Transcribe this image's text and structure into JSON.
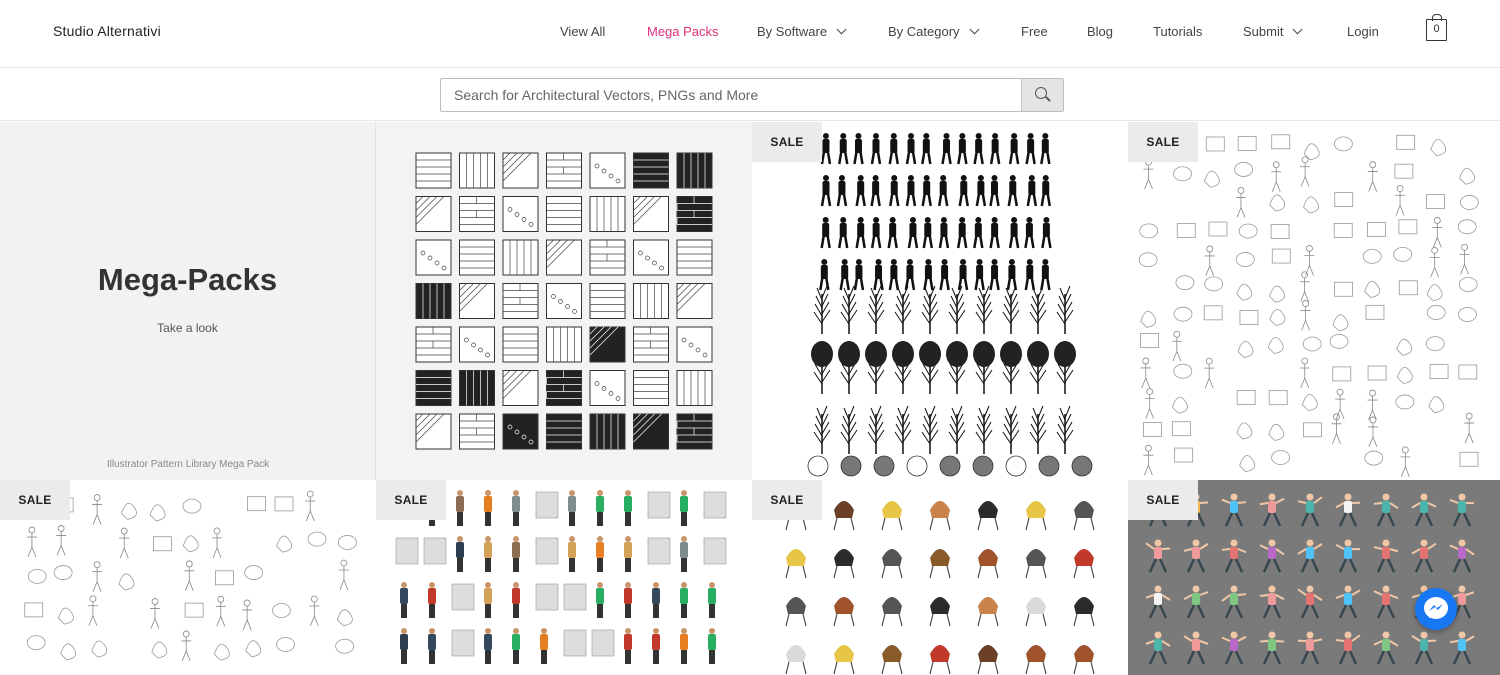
{
  "header": {
    "logo": "Studio Alternativi",
    "cart_count": "0"
  },
  "nav": [
    {
      "label": "View All",
      "active": false,
      "dropdown": false
    },
    {
      "label": "Mega Packs",
      "active": true,
      "dropdown": false
    },
    {
      "label": "By Software",
      "active": false,
      "dropdown": true
    },
    {
      "label": "By Category",
      "active": false,
      "dropdown": true
    },
    {
      "label": "Free",
      "active": false,
      "dropdown": false
    },
    {
      "label": "Blog",
      "active": false,
      "dropdown": false
    },
    {
      "label": "Tutorials",
      "active": false,
      "dropdown": false
    },
    {
      "label": "Submit",
      "active": false,
      "dropdown": true
    },
    {
      "label": "Login",
      "active": false,
      "dropdown": false
    }
  ],
  "search": {
    "placeholder": "Search for Architectural Vectors, PNGs and More",
    "value": ""
  },
  "hero": {
    "title": "Mega-Packs",
    "link": "Take a look"
  },
  "products": {
    "sale_label": "SALE",
    "pattern_caption": "Illustrator Pattern Library Mega Pack"
  },
  "colors": {
    "accent": "#e0317a",
    "messenger": "#1877f2",
    "fitness_bg": "#7a7a7a"
  },
  "icons": {
    "search": "magnifier-icon",
    "cart": "shopping-bag-icon",
    "messenger": "messenger-chat-icon"
  }
}
